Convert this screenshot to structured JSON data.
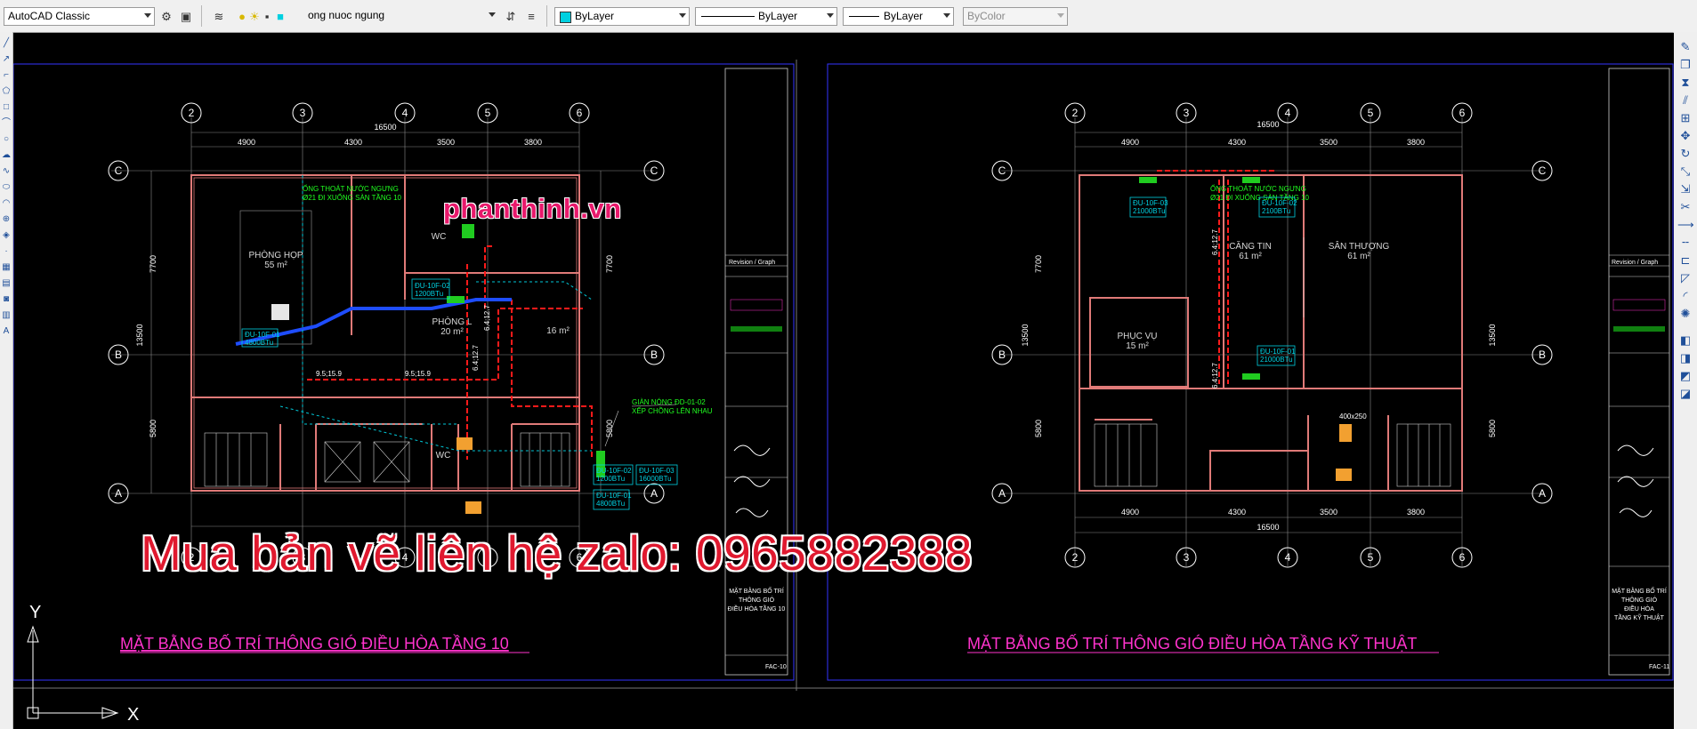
{
  "toolbar": {
    "workspace": "AutoCAD Classic",
    "layer": "ong nuoc ngung",
    "color": "ByLayer",
    "linetype": "ByLayer",
    "lineweight": "ByLayer",
    "plotstyle": "ByColor"
  },
  "drawing": {
    "left_sheet": {
      "title": "MẶT BẰNG BỐ TRÍ THÔNG GIÓ ĐIỀU HÒA TẦNG 10",
      "grid_top": [
        "2",
        "3",
        "4",
        "5",
        "6"
      ],
      "grid_side": [
        "C",
        "B",
        "A"
      ],
      "dim_total": "16500",
      "dims": [
        "4900",
        "4300",
        "3500",
        "3800"
      ],
      "side_dims": [
        "7700",
        "13500",
        "5800"
      ],
      "rooms": [
        "PHÒNG HỌP",
        "55 m²",
        "PHÒNG L",
        "20 m²",
        "16 m²",
        "WC"
      ],
      "labels": [
        "ỐNG THOÁT NƯỚC NGƯNG",
        "Ø21 ĐI XUỐNG SÀN TẦNG 10",
        "ĐU-10F-01",
        "4800BTu",
        "ĐU-10F-02",
        "1200BTu",
        "ĐU-10F-03",
        "16000BTu",
        "9.5;15.9",
        "9.5;15.9",
        "6.4;12.7",
        "GIÀN NÓNG ĐD-01-02",
        "XẾP CHỒNG LÊN NHAU",
        "FAC-10"
      ]
    },
    "right_sheet": {
      "title": "MẶT BẰNG BỐ TRÍ THÔNG GIÓ ĐIỀU HÒA TẦNG KỸ THUẬT",
      "grid_top": [
        "2",
        "3",
        "4",
        "5",
        "6"
      ],
      "grid_side": [
        "C",
        "B",
        "A"
      ],
      "dim_total": "16500",
      "dim_bottom": "16500",
      "dims": [
        "4900",
        "4300",
        "3500",
        "3800"
      ],
      "side_dims": [
        "7700",
        "13500",
        "5800"
      ],
      "rooms": [
        "CĂNG TIN",
        "61 m²",
        "SÂN THƯỢNG",
        "61 m²",
        "PHỤC VỤ",
        "15 m²"
      ],
      "labels": [
        "ỐNG THOÁT NƯỚC NGƯNG",
        "Ø21 ĐI XUỐNG SÀN TẦNG 10",
        "ĐU-10F-03",
        "21000BTu",
        "ĐU-10F-02",
        "2100BTu",
        "ĐU-10F-01",
        "21000BTu",
        "6.4;12.7",
        "6.4;12.7",
        "400x250",
        "FAC-11"
      ]
    },
    "title_block": {
      "revision": "Revision / Graph",
      "left_caption": "MẶT BẰNG BỐ TRÍ THÔNG GIÓ ĐIỀU HÒA TẦNG 10",
      "right_caption": "MẶT BẰNG BỐ TRÍ THÔNG GIÓ ĐIỀU HÒA TẦNG KỸ THUẬT"
    },
    "ucs": {
      "x": "X",
      "y": "Y"
    }
  },
  "watermark": {
    "site": "phanthinh.vn",
    "contact": "Mua bản vẽ liên hệ zalo: 0965882388"
  },
  "colors": {
    "background": "#000000",
    "grid": "#9a9a9a",
    "wall": "#e07a78",
    "pipe_red": "#ff1a1a",
    "duct_blue": "#1e4dff",
    "pipe_cyan": "#00c8d8",
    "label_magenta": "#ff33cc",
    "label_green": "#20ff20",
    "border_blue": "#3333ff"
  }
}
